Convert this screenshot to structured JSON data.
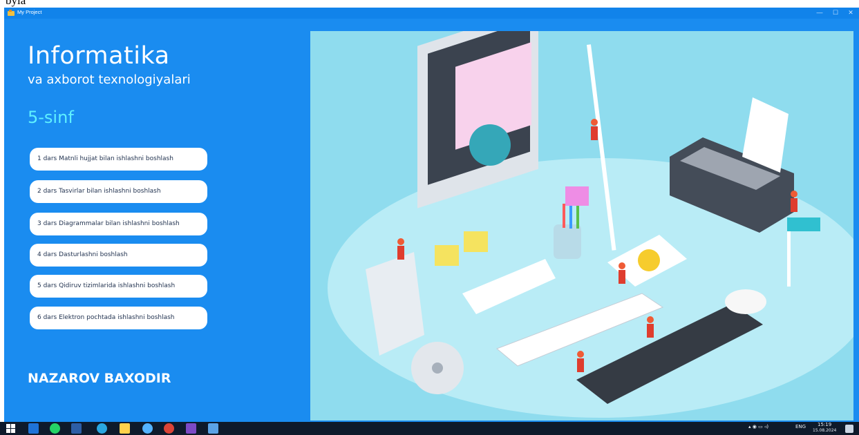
{
  "window": {
    "title": "My Project",
    "minimize_label": "—",
    "maximize_label": "☐",
    "close_label": "✕"
  },
  "header": {
    "title": "Informatika",
    "subtitle": "va axborot texnologiyalari",
    "grade": "5-sinf"
  },
  "lessons": [
    "1 dars Matnli hujjat bilan ishlashni boshlash",
    "2 dars Tasvirlar bilan ishlashni boshlash",
    "3 dars Diagrammalar bilan ishlashni boshlash",
    "4 dars Dasturlashni boshlash",
    "5 dars Qidiruv tizimlarida ishlashni boshlash",
    "6 dars Elektron pochtada ishlashni boshlash"
  ],
  "author": "NAZAROV BAXODIR",
  "taskbar": {
    "language": "ENG",
    "time": "15:19",
    "date": "15.08.2024"
  },
  "colors": {
    "window_bg": "#1a8cf0",
    "illustration_bg": "#8fdcee",
    "grade_text": "#5ff0ff",
    "taskbar_bg": "#0e1a2b"
  },
  "icons": [
    "app-icon",
    "windows-start-icon",
    "windows10-icon",
    "whatsapp-icon",
    "word-icon",
    "telegram-icon",
    "file-explorer-icon",
    "browser-icon",
    "chrome-icon",
    "app-icon",
    "project-icon"
  ]
}
